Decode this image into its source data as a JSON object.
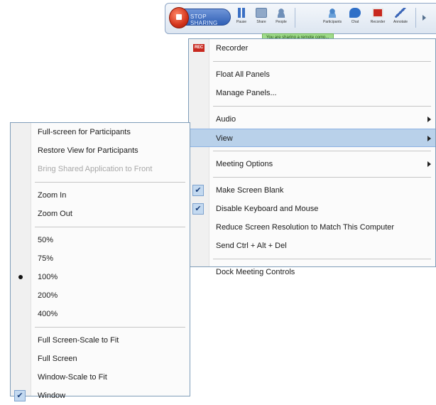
{
  "toolbar": {
    "stop_label": "STOP SHARING",
    "buttons": [
      {
        "label": "Pause",
        "icon": "pause-icon",
        "color": "#3a6fc4"
      },
      {
        "label": "Share",
        "icon": "share-icon",
        "color": "#6f8fb8"
      },
      {
        "label": "People",
        "icon": "people-icon",
        "color": "#6f8fb8"
      },
      {
        "label": "Participants",
        "icon": "participants-icon",
        "color": "#4a86c9"
      },
      {
        "label": "Chat",
        "icon": "chat-icon",
        "color": "#2f6fc7"
      },
      {
        "label": "Recorder",
        "icon": "recorder-icon",
        "color": "#c8281e"
      },
      {
        "label": "Annotate",
        "icon": "annotate-icon",
        "color": "#3b66b8"
      }
    ],
    "share_note": "You are sharing a remote comp..."
  },
  "main_menu": {
    "items": [
      {
        "label": "Recorder",
        "icon_text": "REC"
      },
      {
        "label": "Float All Panels"
      },
      {
        "label": "Manage Panels..."
      },
      {
        "label": "Audio"
      },
      {
        "label": "View"
      },
      {
        "label": "Meeting Options"
      },
      {
        "label": "Make Screen Blank"
      },
      {
        "label": "Disable Keyboard and Mouse"
      },
      {
        "label": "Reduce Screen Resolution to Match This Computer"
      },
      {
        "label": "Send Ctrl + Alt + Del"
      },
      {
        "label": "Dock Meeting Controls"
      }
    ]
  },
  "view_menu": {
    "items": [
      {
        "label": "Full-screen for Participants"
      },
      {
        "label": "Restore View for Participants"
      },
      {
        "label": "Bring Shared Application to Front"
      },
      {
        "label": "Zoom In"
      },
      {
        "label": "Zoom Out"
      },
      {
        "label": "50%"
      },
      {
        "label": "75%"
      },
      {
        "label": "100%"
      },
      {
        "label": "200%"
      },
      {
        "label": "400%"
      },
      {
        "label": "Full Screen-Scale to Fit"
      },
      {
        "label": "Full Screen"
      },
      {
        "label": "Window-Scale to Fit"
      },
      {
        "label": "Window"
      }
    ]
  },
  "colors": {
    "highlight": "#b9d1ea",
    "check_bg": "#c3d9f0",
    "menu_border": "#7f9db9"
  }
}
